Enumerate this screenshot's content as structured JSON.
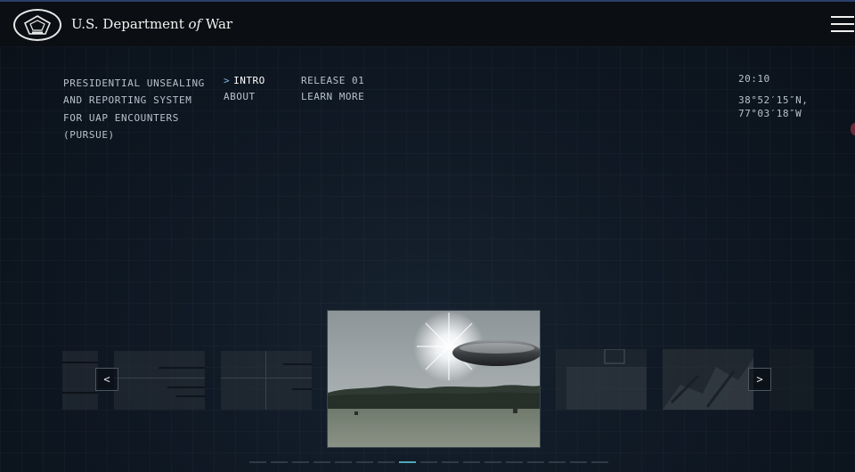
{
  "header": {
    "brand_prefix": "U.S. Department ",
    "brand_of": "of",
    "brand_suffix": " War",
    "logo_icon": "pentagon-seal-icon",
    "menu_icon": "hamburger-menu-icon"
  },
  "system": {
    "title_lines": [
      "PRESIDENTIAL UNSEALING",
      "AND REPORTING SYSTEM",
      "FOR UAP ENCOUNTERS",
      "(PURSUE)"
    ]
  },
  "nav": {
    "active_marker": ">",
    "intro": "INTRO",
    "about": "ABOUT",
    "release": "RELEASE 01",
    "learn_more": "LEARN MORE"
  },
  "status": {
    "time": "20:10",
    "lat": "38°52′15″N,",
    "lon": "77°03′18″W"
  },
  "carousel": {
    "prev_label": "<",
    "next_label": ">",
    "selected_image": "ufo-disc-over-field",
    "page_count": 17,
    "active_page": 7
  },
  "colors": {
    "background": "#0e1722",
    "header": "#0b0e12",
    "accent": "#4fa6b8"
  }
}
